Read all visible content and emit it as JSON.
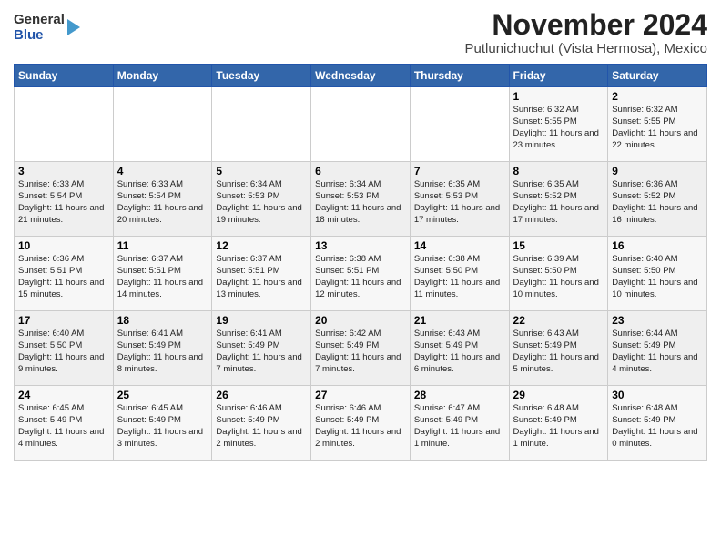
{
  "header": {
    "logo": {
      "general": "General",
      "blue": "Blue"
    },
    "title": "November 2024",
    "subtitle": "Putlunichuchut (Vista Hermosa), Mexico"
  },
  "weekdays": [
    "Sunday",
    "Monday",
    "Tuesday",
    "Wednesday",
    "Thursday",
    "Friday",
    "Saturday"
  ],
  "weeks": [
    [
      {
        "day": "",
        "info": ""
      },
      {
        "day": "",
        "info": ""
      },
      {
        "day": "",
        "info": ""
      },
      {
        "day": "",
        "info": ""
      },
      {
        "day": "",
        "info": ""
      },
      {
        "day": "1",
        "info": "Sunrise: 6:32 AM\nSunset: 5:55 PM\nDaylight: 11 hours and 23 minutes."
      },
      {
        "day": "2",
        "info": "Sunrise: 6:32 AM\nSunset: 5:55 PM\nDaylight: 11 hours and 22 minutes."
      }
    ],
    [
      {
        "day": "3",
        "info": "Sunrise: 6:33 AM\nSunset: 5:54 PM\nDaylight: 11 hours and 21 minutes."
      },
      {
        "day": "4",
        "info": "Sunrise: 6:33 AM\nSunset: 5:54 PM\nDaylight: 11 hours and 20 minutes."
      },
      {
        "day": "5",
        "info": "Sunrise: 6:34 AM\nSunset: 5:53 PM\nDaylight: 11 hours and 19 minutes."
      },
      {
        "day": "6",
        "info": "Sunrise: 6:34 AM\nSunset: 5:53 PM\nDaylight: 11 hours and 18 minutes."
      },
      {
        "day": "7",
        "info": "Sunrise: 6:35 AM\nSunset: 5:53 PM\nDaylight: 11 hours and 17 minutes."
      },
      {
        "day": "8",
        "info": "Sunrise: 6:35 AM\nSunset: 5:52 PM\nDaylight: 11 hours and 17 minutes."
      },
      {
        "day": "9",
        "info": "Sunrise: 6:36 AM\nSunset: 5:52 PM\nDaylight: 11 hours and 16 minutes."
      }
    ],
    [
      {
        "day": "10",
        "info": "Sunrise: 6:36 AM\nSunset: 5:51 PM\nDaylight: 11 hours and 15 minutes."
      },
      {
        "day": "11",
        "info": "Sunrise: 6:37 AM\nSunset: 5:51 PM\nDaylight: 11 hours and 14 minutes."
      },
      {
        "day": "12",
        "info": "Sunrise: 6:37 AM\nSunset: 5:51 PM\nDaylight: 11 hours and 13 minutes."
      },
      {
        "day": "13",
        "info": "Sunrise: 6:38 AM\nSunset: 5:51 PM\nDaylight: 11 hours and 12 minutes."
      },
      {
        "day": "14",
        "info": "Sunrise: 6:38 AM\nSunset: 5:50 PM\nDaylight: 11 hours and 11 minutes."
      },
      {
        "day": "15",
        "info": "Sunrise: 6:39 AM\nSunset: 5:50 PM\nDaylight: 11 hours and 10 minutes."
      },
      {
        "day": "16",
        "info": "Sunrise: 6:40 AM\nSunset: 5:50 PM\nDaylight: 11 hours and 10 minutes."
      }
    ],
    [
      {
        "day": "17",
        "info": "Sunrise: 6:40 AM\nSunset: 5:50 PM\nDaylight: 11 hours and 9 minutes."
      },
      {
        "day": "18",
        "info": "Sunrise: 6:41 AM\nSunset: 5:49 PM\nDaylight: 11 hours and 8 minutes."
      },
      {
        "day": "19",
        "info": "Sunrise: 6:41 AM\nSunset: 5:49 PM\nDaylight: 11 hours and 7 minutes."
      },
      {
        "day": "20",
        "info": "Sunrise: 6:42 AM\nSunset: 5:49 PM\nDaylight: 11 hours and 7 minutes."
      },
      {
        "day": "21",
        "info": "Sunrise: 6:43 AM\nSunset: 5:49 PM\nDaylight: 11 hours and 6 minutes."
      },
      {
        "day": "22",
        "info": "Sunrise: 6:43 AM\nSunset: 5:49 PM\nDaylight: 11 hours and 5 minutes."
      },
      {
        "day": "23",
        "info": "Sunrise: 6:44 AM\nSunset: 5:49 PM\nDaylight: 11 hours and 4 minutes."
      }
    ],
    [
      {
        "day": "24",
        "info": "Sunrise: 6:45 AM\nSunset: 5:49 PM\nDaylight: 11 hours and 4 minutes."
      },
      {
        "day": "25",
        "info": "Sunrise: 6:45 AM\nSunset: 5:49 PM\nDaylight: 11 hours and 3 minutes."
      },
      {
        "day": "26",
        "info": "Sunrise: 6:46 AM\nSunset: 5:49 PM\nDaylight: 11 hours and 2 minutes."
      },
      {
        "day": "27",
        "info": "Sunrise: 6:46 AM\nSunset: 5:49 PM\nDaylight: 11 hours and 2 minutes."
      },
      {
        "day": "28",
        "info": "Sunrise: 6:47 AM\nSunset: 5:49 PM\nDaylight: 11 hours and 1 minute."
      },
      {
        "day": "29",
        "info": "Sunrise: 6:48 AM\nSunset: 5:49 PM\nDaylight: 11 hours and 1 minute."
      },
      {
        "day": "30",
        "info": "Sunrise: 6:48 AM\nSunset: 5:49 PM\nDaylight: 11 hours and 0 minutes."
      }
    ]
  ]
}
